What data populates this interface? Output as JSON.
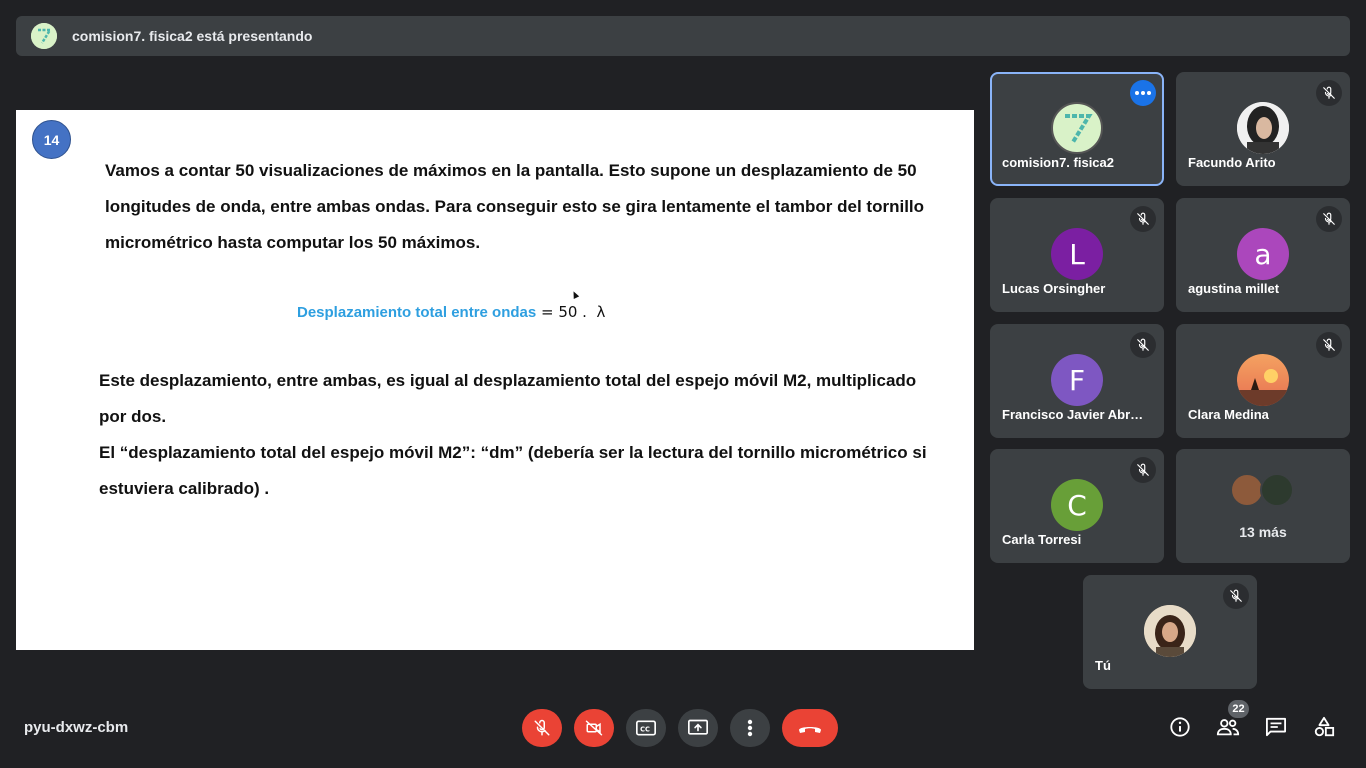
{
  "banner": {
    "text": "comision7. fisica2 está presentando"
  },
  "slide": {
    "number": "14",
    "paragraph1": "Vamos a contar  50 visualizaciones de máximos en la pantalla. Esto supone un desplazamiento de 50 longitudes de onda, entre ambas ondas. Para conseguir esto se gira lentamente el tambor del tornillo micrométrico hasta computar los 50 máximos.",
    "formula_label": "Desplazamiento total entre ondas",
    "formula_rest": " = 50 .  λ",
    "paragraph2": "Este desplazamiento, entre ambas, es igual al desplazamiento total del espejo móvil M2, multiplicado por dos.",
    "paragraph3": "El “desplazamiento total del espejo móvil M2”:  “dm” (debería ser la lectura del tornillo micrométrico si estuviera calibrado) ."
  },
  "participants": [
    {
      "name": "comision7. fisica2",
      "avatar_type": "image"
    },
    {
      "name": "Facundo Arito",
      "avatar_type": "photo"
    },
    {
      "name": "Lucas Orsingher",
      "initial": "L",
      "color": "#7b1fa2"
    },
    {
      "name": "agustina millet",
      "initial": "a",
      "color": "#ab47bc"
    },
    {
      "name": "Francisco Javier Abr…",
      "initial": "F",
      "color": "#7e57c2"
    },
    {
      "name": "Clara Medina",
      "avatar_type": "photo"
    },
    {
      "name": "Carla Torresi",
      "initial": "C",
      "color": "#689f38"
    },
    {
      "name": "Tú",
      "avatar_type": "photo"
    }
  ],
  "more_tile": {
    "label": "13 más"
  },
  "footer": {
    "meeting_code": "pyu-dxwz-cbm",
    "people_count": "22"
  },
  "colors": {
    "background": "#202124",
    "surface": "#3c4043",
    "danger": "#ea4335",
    "accent": "#1a73e8",
    "formula_blue": "#2e9fe0",
    "slide_badge": "#4472c4"
  },
  "icons": {
    "mic_off": "mic-off-icon",
    "cam_off": "videocam-off-icon",
    "captions": "closed-captions-icon",
    "present": "present-screen-icon",
    "more": "more-vert-icon",
    "hangup": "call-end-icon",
    "info": "info-icon",
    "people": "people-icon",
    "chat": "chat-icon",
    "activities": "activities-icon"
  }
}
